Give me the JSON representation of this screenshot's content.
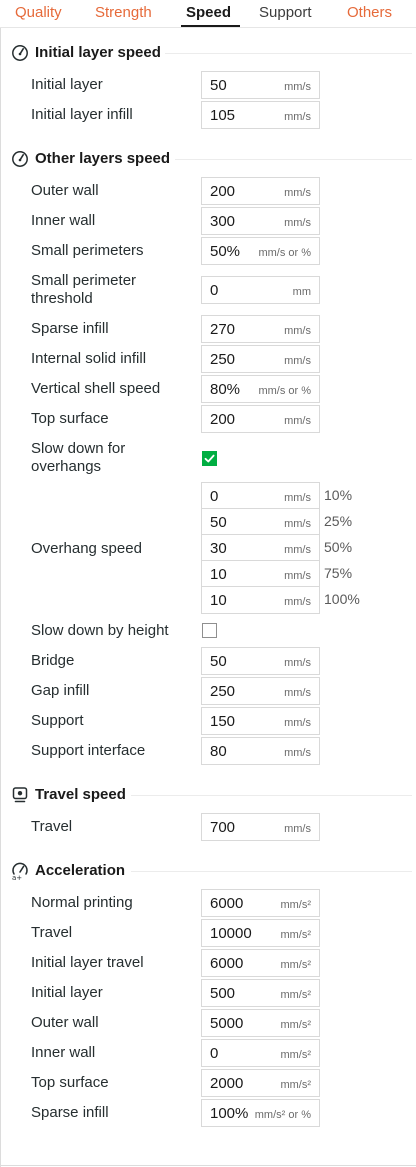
{
  "tabs": {
    "quality": "Quality",
    "strength": "Strength",
    "speed": "Speed",
    "support": "Support",
    "others": "Others"
  },
  "initial_layer_speed": {
    "title": "Initial layer speed",
    "initial_layer": {
      "label": "Initial layer",
      "value": "50",
      "unit": "mm/s"
    },
    "initial_layer_infill": {
      "label": "Initial layer infill",
      "value": "105",
      "unit": "mm/s"
    }
  },
  "other_layers_speed": {
    "title": "Other layers speed",
    "outer_wall": {
      "label": "Outer wall",
      "value": "200",
      "unit": "mm/s"
    },
    "inner_wall": {
      "label": "Inner wall",
      "value": "300",
      "unit": "mm/s"
    },
    "small_perimeters": {
      "label": "Small perimeters",
      "value": "50%",
      "unit": "mm/s or %"
    },
    "small_perimeter_threshold": {
      "label_line1": "Small perimeter",
      "label_line2": "threshold",
      "value": "0",
      "unit": "mm"
    },
    "sparse_infill": {
      "label": "Sparse infill",
      "value": "270",
      "unit": "mm/s"
    },
    "internal_solid_infill": {
      "label": "Internal solid infill",
      "value": "250",
      "unit": "mm/s"
    },
    "vertical_shell_speed": {
      "label": "Vertical shell speed",
      "value": "80%",
      "unit": "mm/s or %"
    },
    "top_surface": {
      "label": "Top surface",
      "value": "200",
      "unit": "mm/s"
    },
    "slow_down_overhangs": {
      "label_line1": "Slow down for",
      "label_line2": "overhangs",
      "checked": true
    },
    "overhang_speed": {
      "label": "Overhang speed",
      "unit": "mm/s",
      "rows": [
        {
          "value": "0",
          "percent": "10%"
        },
        {
          "value": "50",
          "percent": "25%"
        },
        {
          "value": "30",
          "percent": "50%"
        },
        {
          "value": "10",
          "percent": "75%"
        },
        {
          "value": "10",
          "percent": "100%"
        }
      ]
    },
    "slow_down_by_height": {
      "label": "Slow down by height",
      "checked": false
    },
    "bridge": {
      "label": "Bridge",
      "value": "50",
      "unit": "mm/s"
    },
    "gap_infill": {
      "label": "Gap infill",
      "value": "250",
      "unit": "mm/s"
    },
    "support": {
      "label": "Support",
      "value": "150",
      "unit": "mm/s"
    },
    "support_interface": {
      "label": "Support interface",
      "value": "80",
      "unit": "mm/s"
    }
  },
  "travel_speed": {
    "title": "Travel speed",
    "travel": {
      "label": "Travel",
      "value": "700",
      "unit": "mm/s"
    }
  },
  "acceleration": {
    "title": "Acceleration",
    "normal_printing": {
      "label": "Normal printing",
      "value": "6000",
      "unit": "mm/s²"
    },
    "travel": {
      "label": "Travel",
      "value": "10000",
      "unit": "mm/s²"
    },
    "initial_layer_travel": {
      "label": "Initial layer travel",
      "value": "6000",
      "unit": "mm/s²"
    },
    "initial_layer": {
      "label": "Initial layer",
      "value": "500",
      "unit": "mm/s²"
    },
    "outer_wall": {
      "label": "Outer wall",
      "value": "5000",
      "unit": "mm/s²"
    },
    "inner_wall": {
      "label": "Inner wall",
      "value": "0",
      "unit": "mm/s²"
    },
    "top_surface": {
      "label": "Top surface",
      "value": "2000",
      "unit": "mm/s²"
    },
    "sparse_infill": {
      "label": "Sparse infill",
      "value": "100%",
      "unit": "mm/s² or %"
    }
  },
  "colors": {
    "accent": "#e66a3a",
    "check": "#00ae42",
    "text": "#262e30",
    "border": "#d9d9d9"
  }
}
